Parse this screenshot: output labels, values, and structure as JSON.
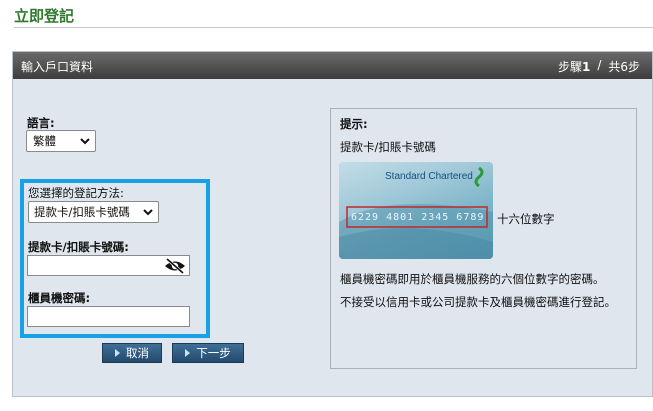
{
  "page": {
    "title": "立即登記"
  },
  "panel": {
    "title": "輸入戶口資料",
    "step_label": "步驟",
    "step_current": "1",
    "step_separator": "/",
    "step_total": "共6步"
  },
  "form": {
    "language_label": "語言:",
    "language_value": "繁體",
    "method_label": "您選擇的登記方法:",
    "method_value": "提款卡/扣賬卡號碼",
    "card_label": "提款卡/扣賬卡號碼:",
    "pin_label": "櫃員機密碼:"
  },
  "buttons": {
    "cancel": "取消",
    "next": "下一步"
  },
  "tip": {
    "title": "提示:",
    "subtitle": "提款卡/扣賬卡號碼",
    "card_brand": "Standard Chartered",
    "card_number": "6229 4801 2345 6789",
    "card_note": "十六位數字",
    "text1": "櫃員機密碼即用於櫃員機服務的六個位數字的密碼。",
    "text2": "不接受以信用卡或公司提款卡及櫃員機密碼進行登記。"
  },
  "colors": {
    "title_green": "#2f7a2e",
    "highlight_blue": "#17a2e8",
    "button_blue": "#2d5a82",
    "panel_bg": "#dfe6ed"
  },
  "icons": {
    "eye": "eye-slash-icon",
    "dropdown": "chevron-down-icon",
    "button_arrow": "triangle-right-icon"
  }
}
